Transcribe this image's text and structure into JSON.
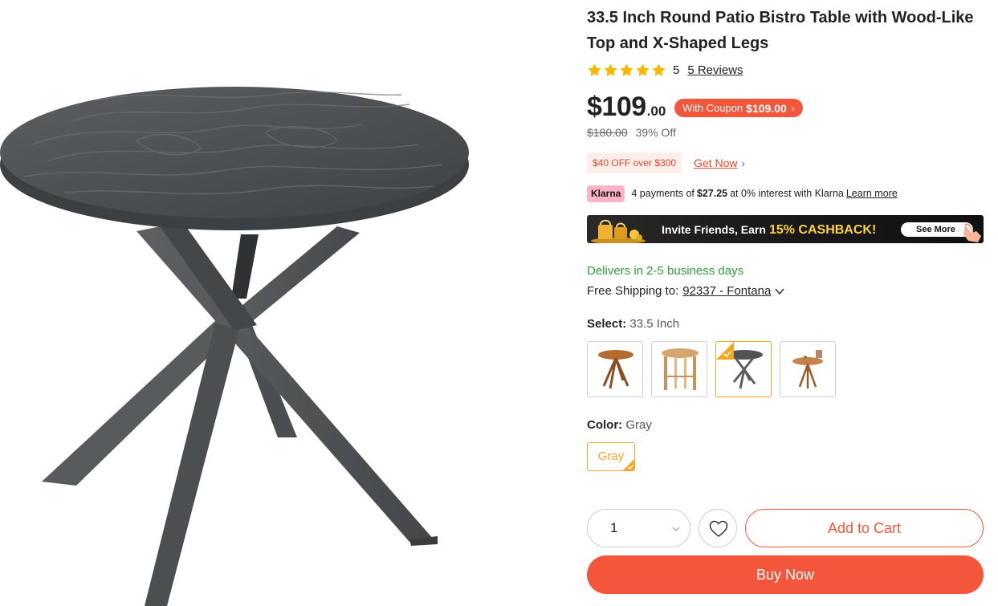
{
  "product": {
    "title": "33.5 Inch Round Patio Bistro Table with Wood-Like Top and X-Shaped Legs",
    "image_alt": "gray round patio bistro table with X-shaped legs"
  },
  "rating": {
    "stars": 5,
    "value": "5",
    "reviews_label": "5 Reviews"
  },
  "price": {
    "currency_main": "$109",
    "cents": ".00",
    "coupon_label": "With Coupon",
    "coupon_price": "$109.00",
    "coupon_chevron": "›",
    "original": "$180.00",
    "discount": "39% Off"
  },
  "promo": {
    "badge": "$40 OFF over $300",
    "link": "Get Now",
    "chevron": "›"
  },
  "klarna": {
    "badge": "Klarna",
    "text_before": "4 payments of",
    "amount": "$27.25",
    "text_after": "at 0% interest with Klarna",
    "learn_more": "Learn more"
  },
  "banner": {
    "text": "Invite Friends, Earn",
    "highlight": "15% CASHBACK!",
    "button": "See More"
  },
  "delivery": {
    "delivers": "Delivers in 2-5 business days",
    "shipping_label": "Free Shipping to:",
    "zip": "92337 - Fontana"
  },
  "size_select": {
    "label": "Select:",
    "value": "33.5 Inch",
    "options": [
      "teak-x-base-table",
      "natural-wood-table",
      "gray-x-leg-table",
      "teak-table-with-chairs"
    ],
    "selected_index": 2
  },
  "color_select": {
    "label": "Color:",
    "value": "Gray",
    "option": "Gray"
  },
  "cart": {
    "quantity": "1",
    "add_to_cart": "Add to Cart",
    "buy_now": "Buy Now"
  },
  "colors": {
    "accent": "#f4563b",
    "selected_border": "#f5a623",
    "delivery_green": "#2e9e3b",
    "star": "#f5b800",
    "table_gray": "#4f5356"
  }
}
